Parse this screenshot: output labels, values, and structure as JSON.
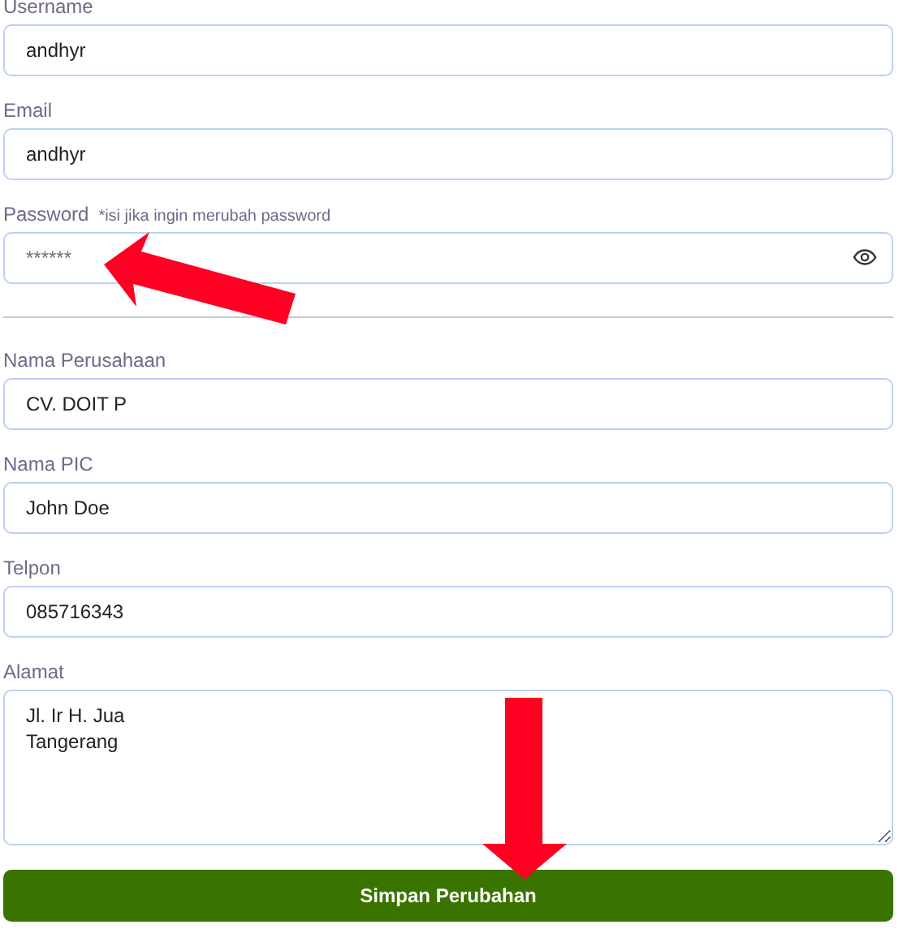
{
  "account_fields": [
    {
      "label": "Username",
      "value": "andhyr"
    },
    {
      "label": "Email",
      "value": "andhyr"
    },
    {
      "label": "Password",
      "note": "*isi jika ingin merubah password",
      "placeholder": "******",
      "kind": "password"
    }
  ],
  "company_fields": [
    {
      "label": "Nama Perusahaan",
      "value": "CV. DOIT P"
    },
    {
      "label": "Nama PIC",
      "value": "John Doe"
    },
    {
      "label": "Telpon",
      "value": "085716343"
    },
    {
      "label": "Alamat",
      "lines": [
        "Jl. Ir H. Jua",
        "Tangerang"
      ],
      "kind": "textarea"
    }
  ],
  "submit_button": "Simpan Perubahan"
}
